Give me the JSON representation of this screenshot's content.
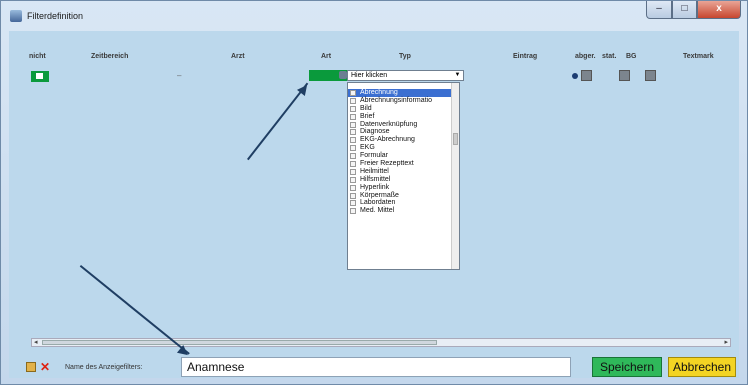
{
  "window": {
    "title": "Filterdefinition",
    "min_label": "–",
    "max_label": "□",
    "close_label": "x"
  },
  "columns": [
    "nicht",
    "Zeitbereich",
    "Arzt",
    "Art",
    "Typ",
    "Eintrag",
    "abger.",
    "stat.",
    "BG",
    "Textmark"
  ],
  "row": {
    "zeitbereich": "–",
    "typ_value": "Hier klicken",
    "combo_arrow": "▼"
  },
  "dropdown": {
    "items": [
      "Abrechnung",
      "Abrechnungsinformatio",
      "Bild",
      "Brief",
      "Datenverknüpfung",
      "Diagnose",
      "EKG-Abrechnung",
      "EKG",
      "Formular",
      "Freier Rezepttext",
      "Heilmittel",
      "Hilfsmittel",
      "Hyperlink",
      "Körpermaße",
      "Labordaten",
      "Med. Mittel"
    ],
    "selected": "Abrechnung"
  },
  "scrollbar": {
    "left_arrow": "◂",
    "right_arrow": "▸"
  },
  "bottom": {
    "name_label": "Name des Anzeigefilters:",
    "name_value": "Anamnese",
    "save_label": "Speichern",
    "cancel_label": "Abbrechen"
  },
  "colors": {
    "accent_green": "#0a9a3c",
    "save_green": "#2fb85a",
    "cancel_yellow": "#f3d423",
    "selection_blue": "#3b6fd1",
    "arrow": "#1f3e63"
  }
}
